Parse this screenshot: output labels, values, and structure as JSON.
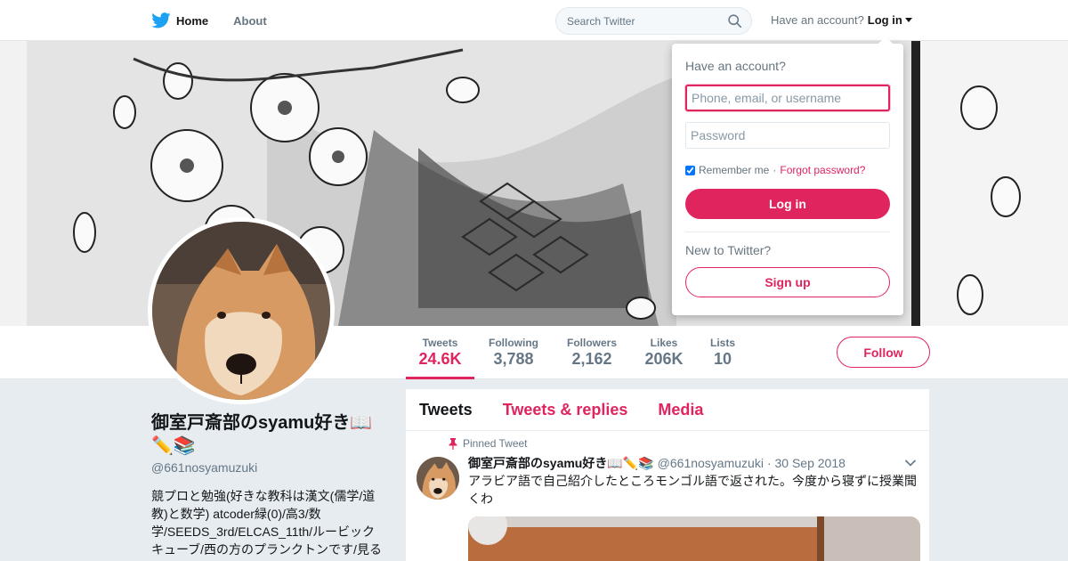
{
  "topbar": {
    "home_label": "Home",
    "about_label": "About",
    "search_placeholder": "Search Twitter",
    "have_account_text": "Have an account?",
    "login_label": "Log in"
  },
  "profile_nav": {
    "stats": [
      {
        "label": "Tweets",
        "value": "24.6K"
      },
      {
        "label": "Following",
        "value": "3,788"
      },
      {
        "label": "Followers",
        "value": "2,162"
      },
      {
        "label": "Likes",
        "value": "206K"
      },
      {
        "label": "Lists",
        "value": "10"
      }
    ],
    "follow_label": "Follow"
  },
  "profile": {
    "name": "御室戸斎部のsyamu好き📖✏️📚",
    "handle": "@661nosyamuzuki",
    "bio": "競プロと勉強(好きな教科は漢文(儒学/道教)と数学) atcoder緑(0)/高3/数学/SEEDS_3rd/ELCAS_11th/ルービックキューブ/西の方のプランクトンです/見る"
  },
  "timeline": {
    "tabs": [
      "Tweets",
      "Tweets & replies",
      "Media"
    ],
    "pinned_label": "Pinned Tweet",
    "tweet": {
      "name": "御室戸斎部のsyamu好き📖✏️📚",
      "handle": "@661nosyamuzuki",
      "date": "· 30 Sep 2018",
      "text": "アラビア語で自己紹介したところモンゴル語で返された。今度から寝ずに授業聞くわ"
    }
  },
  "login_dropdown": {
    "title": "Have an account?",
    "username_placeholder": "Phone, email, or username",
    "password_placeholder": "Password",
    "remember_label": "Remember me",
    "separator": "·",
    "forgot_label": "Forgot password?",
    "login_button": "Log in",
    "new_text": "New to Twitter?",
    "signup_button": "Sign up"
  },
  "colors": {
    "accent": "#e0245e",
    "twitter_blue": "#1da1f2",
    "background": "#e6ecf0"
  },
  "icons": [
    "twitter-bird-icon",
    "search-icon",
    "caret-down-icon",
    "pin-icon",
    "chevron-down-icon"
  ]
}
